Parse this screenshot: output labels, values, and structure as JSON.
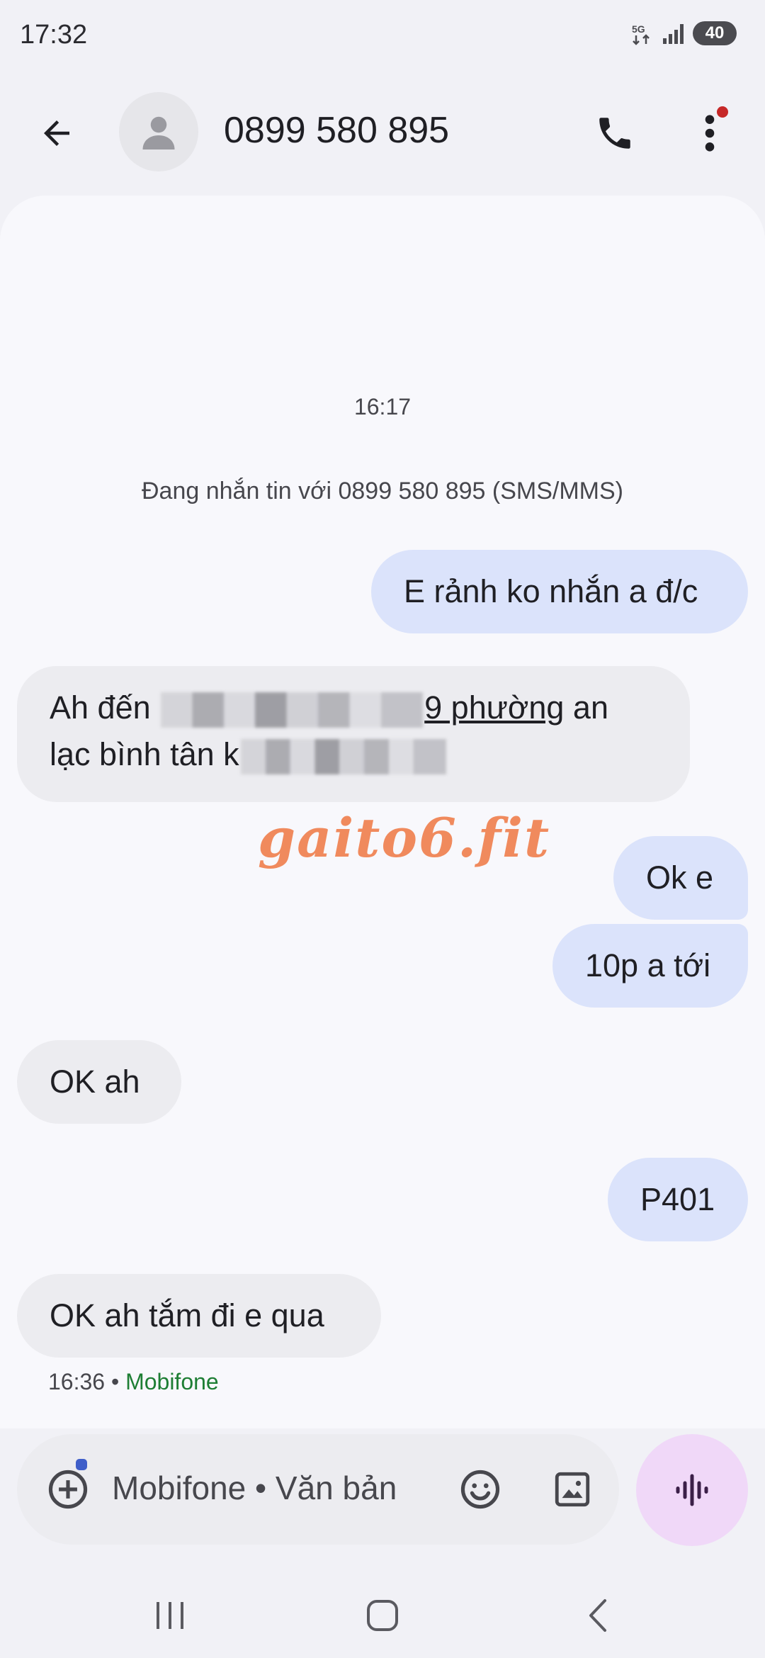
{
  "status_bar": {
    "time": "17:32",
    "network": "5G",
    "battery": "40"
  },
  "header": {
    "title": "0899 580 895",
    "icons": [
      "back-arrow-icon",
      "person-icon",
      "phone-icon",
      "more-vert-icon"
    ]
  },
  "conversation": {
    "time_divider": "16:17",
    "info": "Đang nhắn tin với 0899 580 895 (SMS/MMS)",
    "messages": [
      {
        "direction": "out",
        "text": "E rảnh ko nhắn a đ/c"
      },
      {
        "direction": "in",
        "part1": "Ah đến",
        "part2": "9 phường",
        "part3": " an",
        "part4": "lạc bình tân k"
      },
      {
        "direction": "out",
        "text": "Ok e"
      },
      {
        "direction": "out",
        "text": "10p a tới"
      },
      {
        "direction": "in",
        "text": "OK ah"
      },
      {
        "direction": "out",
        "text": "P401"
      },
      {
        "direction": "in",
        "text": "OK ah tắm đi e qua"
      }
    ],
    "last_time": "16:36",
    "separator": "•",
    "carrier": "Mobifone",
    "watermark": "gaito6.fit"
  },
  "composer": {
    "placeholder": "Mobifone • Văn bản",
    "icons": [
      "add-circle-icon",
      "emoji-icon",
      "image-icon",
      "voice-wave-icon"
    ]
  },
  "nav": {
    "icons": [
      "recents-icon",
      "home-icon",
      "back-icon"
    ]
  },
  "colors": {
    "outgoing_bubble": "#dbe3fb",
    "incoming_bubble": "#ececf0",
    "carrier_text": "#1e7e34",
    "voice_button": "#f0d8f8",
    "watermark": "#f08a5d"
  }
}
